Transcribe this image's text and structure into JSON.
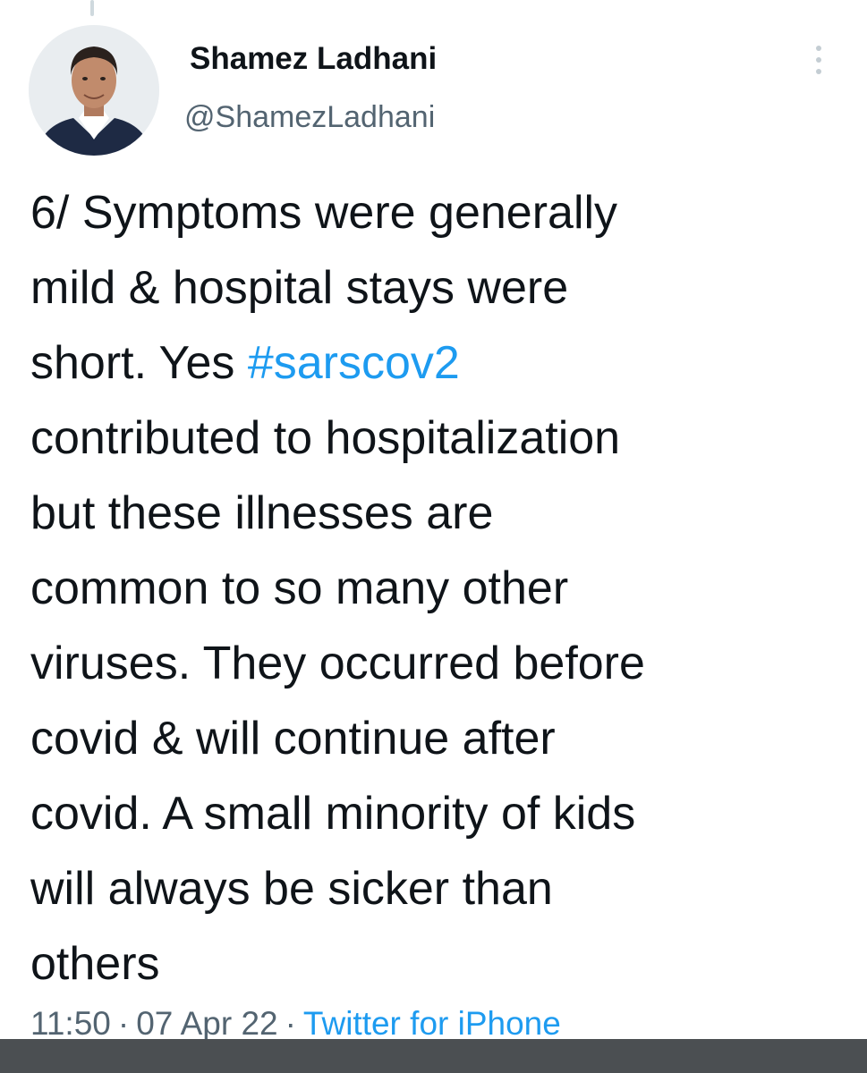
{
  "tweet": {
    "author": {
      "display_name": "Shamez Ladhani",
      "handle": "@ShamezLadhani",
      "avatar_icon": "profile-photo"
    },
    "more_icon": "vertical-ellipsis-icon",
    "lines": [
      [
        {
          "text": "6/ Symptoms were generally"
        }
      ],
      [
        {
          "text": "mild & hospital stays were"
        }
      ],
      [
        {
          "text": "short. Yes "
        },
        {
          "text": "#sarscov2",
          "hashtag": true
        }
      ],
      [
        {
          "text": "contributed to hospitalization"
        }
      ],
      [
        {
          "text": "but these illnesses are"
        }
      ],
      [
        {
          "text": "common to so many other"
        }
      ],
      [
        {
          "text": "viruses. They occurred before"
        }
      ],
      [
        {
          "text": "covid & will continue after"
        }
      ],
      [
        {
          "text": "covid. A small minority of kids"
        }
      ],
      [
        {
          "text": "will always be sicker than"
        }
      ],
      [
        {
          "text": "others"
        }
      ]
    ],
    "meta": {
      "time": "11:50",
      "date": "07 Apr 22",
      "separator": "·",
      "source": "Twitter for iPhone"
    }
  },
  "colors": {
    "text": "#0f1419",
    "secondary": "#536471",
    "link": "#1d9bf0",
    "bottom_bar": "#4b4f52"
  }
}
